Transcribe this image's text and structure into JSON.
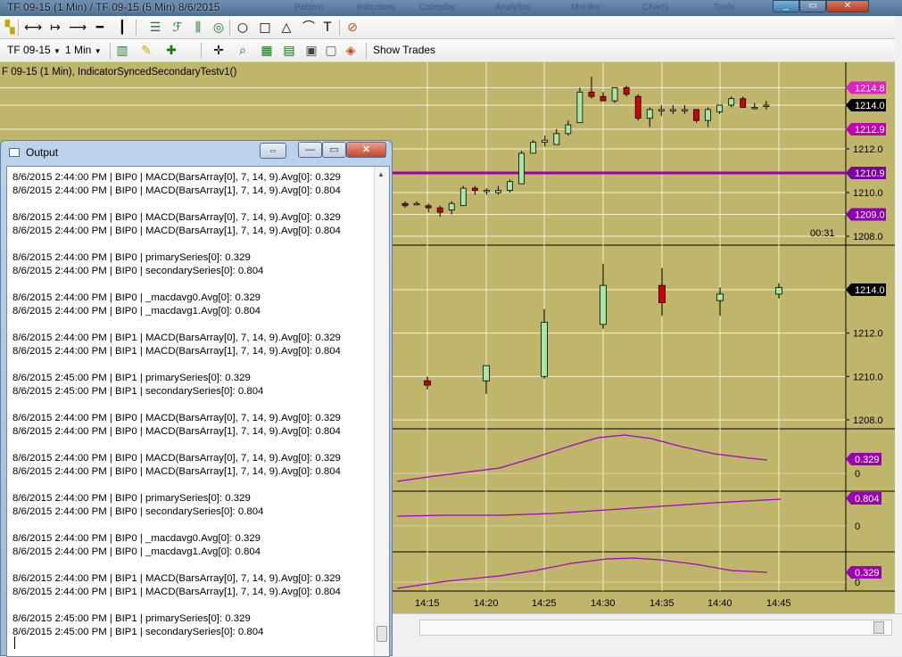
{
  "window": {
    "title": "TF 09-15 (1 Min) / TF 09-15 (5 Min)  8/6/2015",
    "menu_ghosts": [
      "Pattern",
      "indicators",
      "Calendar",
      "Analytics",
      "Monitor",
      "Charts",
      "Tools"
    ],
    "minimize_label": "_",
    "maximize_label": "▭",
    "close_label": "✕"
  },
  "toolbar_top": {
    "icons": [
      {
        "name": "cursor-tool-icon",
        "glyph": "▚",
        "color": "#c9a600"
      },
      {
        "name": "line-segment-icon",
        "glyph": "⟷",
        "color": "#000"
      },
      {
        "name": "ray-icon",
        "glyph": "↦",
        "color": "#000"
      },
      {
        "name": "extended-line-icon",
        "glyph": "⟶",
        "color": "#000"
      },
      {
        "name": "horizontal-line-icon",
        "glyph": "━",
        "color": "#000"
      },
      {
        "name": "vertical-line-icon",
        "glyph": "┃",
        "color": "#000"
      },
      {
        "name": "andrews-pitchfork-icon",
        "glyph": "☰",
        "color": "#1a7a1a"
      },
      {
        "name": "fibonacci-retracement-icon",
        "glyph": "ℱ",
        "color": "#1a7a1a"
      },
      {
        "name": "gann-fan-icon",
        "glyph": "⫼",
        "color": "#1a7a1a"
      },
      {
        "name": "regression-channel-icon",
        "glyph": "◎",
        "color": "#1a7a1a"
      },
      {
        "name": "ellipse-icon",
        "glyph": "○",
        "color": "#000"
      },
      {
        "name": "rectangle-icon",
        "glyph": "□",
        "color": "#000"
      },
      {
        "name": "triangle-icon",
        "glyph": "△",
        "color": "#000"
      },
      {
        "name": "arc-icon",
        "glyph": "⌒",
        "color": "#000"
      },
      {
        "name": "text-icon",
        "glyph": "T",
        "color": "#000"
      },
      {
        "name": "remove-drawings-icon",
        "glyph": "⊘",
        "color": "#c64b1a"
      }
    ]
  },
  "toolbar_bottom": {
    "instrument": "TF 09-15",
    "interval": "1 Min",
    "show_trades": "Show Trades",
    "icons": [
      {
        "name": "bar-type-icon",
        "glyph": "▥",
        "color": "#2a7a2a"
      },
      {
        "name": "drawing-pencil-icon",
        "glyph": "✎",
        "color": "#c9a600"
      },
      {
        "name": "add-indicator-icon",
        "glyph": "✚",
        "color": "#1a7a1a"
      },
      {
        "name": "crosshair-icon",
        "glyph": "✛",
        "color": "#000"
      },
      {
        "name": "zoom-icon",
        "glyph": "⌕",
        "color": "#2a5a8a"
      },
      {
        "name": "data-box-icon",
        "glyph": "▦",
        "color": "#1a6a1a"
      },
      {
        "name": "chart-properties-icon",
        "glyph": "▤",
        "color": "#1a6a1a"
      },
      {
        "name": "chart-template-icon",
        "glyph": "▣",
        "color": "#444"
      },
      {
        "name": "snapshot-icon",
        "glyph": "▢",
        "color": "#555"
      },
      {
        "name": "strategy-icon",
        "glyph": "◈",
        "color": "#c64b1a"
      }
    ]
  },
  "chart": {
    "label": "F 09-15 (1 Min), IndicatorSyncedSecondaryTestv1()",
    "timer": "00:31",
    "background": "#bfb56b",
    "up_candle_color": "#a8e6a8",
    "down_candle_color": "#d40000",
    "indicator_line_color": "#a000c8",
    "main_panel": {
      "price_labels": [
        "1214.8",
        "1214.0",
        "1212.9",
        "1212.0",
        "1210.9",
        "1210.0",
        "1209.0",
        "1208.0"
      ],
      "horizontal_line_label": "1210.9",
      "candles": [
        {
          "o": 1209.5,
          "h": 1209.6,
          "l": 1209.3,
          "c": 1209.4
        },
        {
          "o": 1209.5,
          "h": 1209.6,
          "l": 1209.4,
          "c": 1209.5
        },
        {
          "o": 1209.4,
          "h": 1209.5,
          "l": 1209.1,
          "c": 1209.3
        },
        {
          "o": 1209.3,
          "h": 1209.4,
          "l": 1208.9,
          "c": 1209.1
        },
        {
          "o": 1209.2,
          "h": 1209.6,
          "l": 1209.0,
          "c": 1209.5
        },
        {
          "o": 1209.4,
          "h": 1210.3,
          "l": 1209.4,
          "c": 1210.2
        },
        {
          "o": 1210.2,
          "h": 1210.3,
          "l": 1209.9,
          "c": 1210.1
        },
        {
          "o": 1210.1,
          "h": 1210.2,
          "l": 1209.9,
          "c": 1210.1
        },
        {
          "o": 1210.0,
          "h": 1210.3,
          "l": 1209.9,
          "c": 1210.1
        },
        {
          "o": 1210.1,
          "h": 1210.6,
          "l": 1210.0,
          "c": 1210.5
        },
        {
          "o": 1210.4,
          "h": 1211.9,
          "l": 1210.4,
          "c": 1211.8
        },
        {
          "o": 1211.8,
          "h": 1212.4,
          "l": 1211.8,
          "c": 1212.3
        },
        {
          "o": 1212.3,
          "h": 1212.6,
          "l": 1212.1,
          "c": 1212.4
        },
        {
          "o": 1212.2,
          "h": 1212.9,
          "l": 1212.2,
          "c": 1212.7
        },
        {
          "o": 1212.7,
          "h": 1213.3,
          "l": 1212.6,
          "c": 1213.1
        },
        {
          "o": 1213.2,
          "h": 1214.8,
          "l": 1213.2,
          "c": 1214.6
        },
        {
          "o": 1214.6,
          "h": 1215.3,
          "l": 1214.3,
          "c": 1214.4
        },
        {
          "o": 1214.4,
          "h": 1214.6,
          "l": 1214.2,
          "c": 1214.2
        },
        {
          "o": 1214.2,
          "h": 1214.8,
          "l": 1214.1,
          "c": 1214.8
        },
        {
          "o": 1214.8,
          "h": 1214.9,
          "l": 1214.4,
          "c": 1214.5
        },
        {
          "o": 1214.4,
          "h": 1214.5,
          "l": 1213.3,
          "c": 1213.4
        },
        {
          "o": 1213.4,
          "h": 1213.9,
          "l": 1213.0,
          "c": 1213.8
        },
        {
          "o": 1213.8,
          "h": 1214.0,
          "l": 1213.5,
          "c": 1213.8
        },
        {
          "o": 1213.8,
          "h": 1214.0,
          "l": 1213.6,
          "c": 1213.8
        },
        {
          "o": 1213.8,
          "h": 1214.0,
          "l": 1213.6,
          "c": 1213.8
        },
        {
          "o": 1213.8,
          "h": 1213.8,
          "l": 1213.2,
          "c": 1213.3
        },
        {
          "o": 1213.3,
          "h": 1213.9,
          "l": 1213.0,
          "c": 1213.8
        },
        {
          "o": 1213.7,
          "h": 1214.0,
          "l": 1213.6,
          "c": 1214.0
        },
        {
          "o": 1214.0,
          "h": 1214.4,
          "l": 1213.9,
          "c": 1214.3
        },
        {
          "o": 1214.3,
          "h": 1214.4,
          "l": 1213.9,
          "c": 1213.9
        },
        {
          "o": 1213.9,
          "h": 1214.1,
          "l": 1213.8,
          "c": 1213.9
        },
        {
          "o": 1214.0,
          "h": 1214.2,
          "l": 1213.8,
          "c": 1214.0
        }
      ]
    },
    "secondary_panel": {
      "price_labels": [
        "1214.0",
        "1212.0",
        "1210.0",
        "1208.0"
      ],
      "last_price": "1214.0",
      "candles": [
        {
          "o": 1209.8,
          "h": 1210.0,
          "l": 1209.4,
          "c": 1209.6
        },
        {
          "o": 1209.8,
          "h": 1210.4,
          "l": 1209.2,
          "c": 1210.5
        },
        {
          "o": 1210.0,
          "h": 1213.1,
          "l": 1209.9,
          "c": 1212.5
        },
        {
          "o": 1212.4,
          "h": 1215.2,
          "l": 1212.2,
          "c": 1214.2
        },
        {
          "o": 1214.2,
          "h": 1215.0,
          "l": 1212.8,
          "c": 1213.4
        },
        {
          "o": 1213.5,
          "h": 1214.1,
          "l": 1212.8,
          "c": 1213.8
        },
        {
          "o": 1213.8,
          "h": 1214.3,
          "l": 1213.6,
          "c": 1214.1
        }
      ]
    },
    "indicators": [
      {
        "value_label": "0.329",
        "zero_label": "0"
      },
      {
        "value_label": "0.804",
        "zero_label": "0"
      },
      {
        "value_label": "0.329",
        "zero_label": "0"
      }
    ],
    "time_labels": [
      "14:15",
      "14:20",
      "14:25",
      "14:30",
      "14:35",
      "14:40",
      "14:45"
    ]
  },
  "output_window": {
    "title": "Output",
    "swap_label": "⇔",
    "minimize_label": "—",
    "maximize_label": "▭",
    "close_label": "✕",
    "lines": [
      "8/6/2015 2:44:00 PM | BIP0 | MACD(BarsArray[0], 7, 14, 9).Avg[0]: 0.329",
      "8/6/2015 2:44:00 PM | BIP0 | MACD(BarsArray[1], 7, 14, 9).Avg[0]: 0.804",
      "",
      "8/6/2015 2:44:00 PM | BIP0 | MACD(BarsArray[0], 7, 14, 9).Avg[0]: 0.329",
      "8/6/2015 2:44:00 PM | BIP0 | MACD(BarsArray[1], 7, 14, 9).Avg[0]: 0.804",
      "",
      "8/6/2015 2:44:00 PM | BIP0 | primarySeries[0]: 0.329",
      "8/6/2015 2:44:00 PM | BIP0 | secondarySeries[0]: 0.804",
      "",
      "8/6/2015 2:44:00 PM | BIP0 | _macdavg0.Avg[0]: 0.329",
      "8/6/2015 2:44:00 PM | BIP0 | _macdavg1.Avg[0]: 0.804",
      "",
      "8/6/2015 2:44:00 PM | BIP1 | MACD(BarsArray[0], 7, 14, 9).Avg[0]: 0.329",
      "8/6/2015 2:44:00 PM | BIP1 | MACD(BarsArray[1], 7, 14, 9).Avg[0]: 0.804",
      "",
      "8/6/2015 2:45:00 PM | BIP1 | primarySeries[0]: 0.329",
      "8/6/2015 2:45:00 PM | BIP1 | secondarySeries[0]: 0.804",
      "",
      "8/6/2015 2:44:00 PM | BIP0 | MACD(BarsArray[0], 7, 14, 9).Avg[0]: 0.329",
      "8/6/2015 2:44:00 PM | BIP0 | MACD(BarsArray[1], 7, 14, 9).Avg[0]: 0.804",
      "",
      "8/6/2015 2:44:00 PM | BIP0 | MACD(BarsArray[0], 7, 14, 9).Avg[0]: 0.329",
      "8/6/2015 2:44:00 PM | BIP0 | MACD(BarsArray[1], 7, 14, 9).Avg[0]: 0.804",
      "",
      "8/6/2015 2:44:00 PM | BIP0 | primarySeries[0]: 0.329",
      "8/6/2015 2:44:00 PM | BIP0 | secondarySeries[0]: 0.804",
      "",
      "8/6/2015 2:44:00 PM | BIP0 | _macdavg0.Avg[0]: 0.329",
      "8/6/2015 2:44:00 PM | BIP0 | _macdavg1.Avg[0]: 0.804",
      "",
      "8/6/2015 2:44:00 PM | BIP1 | MACD(BarsArray[0], 7, 14, 9).Avg[0]: 0.329",
      "8/6/2015 2:44:00 PM | BIP1 | MACD(BarsArray[1], 7, 14, 9).Avg[0]: 0.804",
      "",
      "8/6/2015 2:45:00 PM | BIP1 | primarySeries[0]: 0.329",
      "8/6/2015 2:45:00 PM | BIP1 | secondarySeries[0]: 0.804"
    ]
  }
}
